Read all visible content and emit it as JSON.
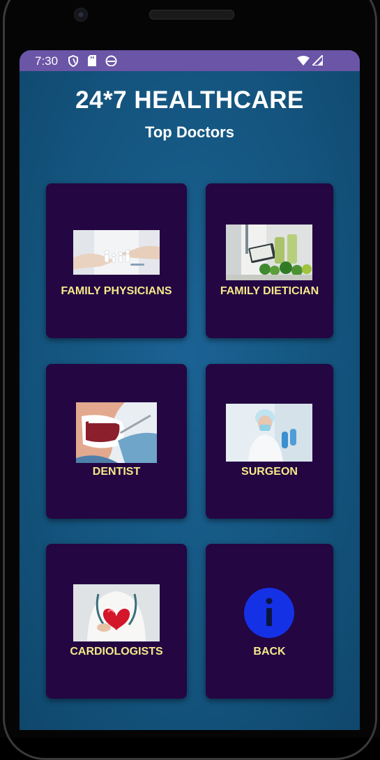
{
  "status_bar": {
    "time": "7:30",
    "left_icons": [
      "shield-icon",
      "sd-card-icon",
      "android-head-icon"
    ],
    "right_icons": [
      "wifi-icon",
      "signal-icon"
    ],
    "color": "#6a55a6"
  },
  "header": {
    "title": "24*7 HEALTHCARE",
    "subtitle": "Top Doctors"
  },
  "cards": [
    {
      "label": "FAMILY PHYSICIANS",
      "icon": "family-care-image"
    },
    {
      "label": "FAMILY DIETICIAN",
      "icon": "dietician-image"
    },
    {
      "label": "DENTIST",
      "icon": "dentist-image"
    },
    {
      "label": "SURGEON",
      "icon": "surgeon-image"
    },
    {
      "label": "CARDIOLOGISTS",
      "icon": "cardiologist-image"
    },
    {
      "label": "BACK",
      "icon": "info-icon"
    }
  ],
  "colors": {
    "card_bg": "#230642",
    "label": "#f6e98a",
    "info_circle": "#1531e6",
    "screen_bg": "#14557f"
  }
}
